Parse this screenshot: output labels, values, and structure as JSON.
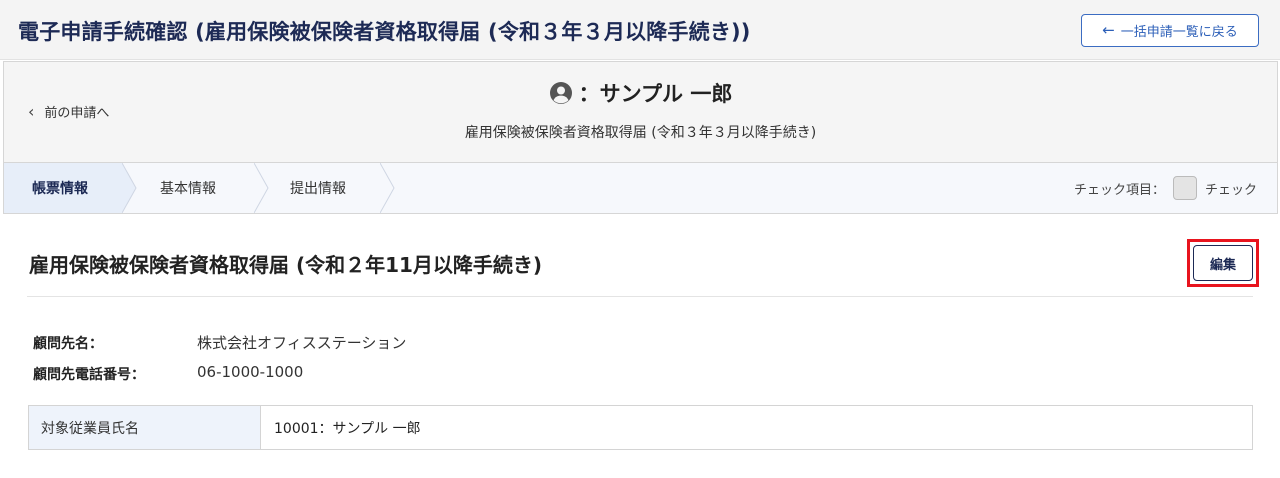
{
  "header": {
    "title": "電子申請手続確認 (雇用保険被保険者資格取得届 (令和３年３月以降手続き))",
    "back_button_label": "一括申請一覧に戻る"
  },
  "card": {
    "prev_label": "前の申請へ",
    "person_name": "：サンプル 一郎",
    "form_name": "雇用保険被保険者資格取得届 (令和３年３月以降手続き)"
  },
  "tabs": [
    {
      "label": "帳票情報",
      "active": true
    },
    {
      "label": "基本情報",
      "active": false
    },
    {
      "label": "提出情報",
      "active": false
    }
  ],
  "check": {
    "label": "チェック項目：",
    "checkbox_label": "チェック"
  },
  "section": {
    "title": "雇用保険被保険者資格取得届 (令和２年11月以降手続き)",
    "edit_label": "編集"
  },
  "info": [
    {
      "label": "顧問先名：",
      "value": "株式会社オフィスステーション"
    },
    {
      "label": "顧問先電話番号：",
      "value": "06-1000-1000"
    }
  ],
  "employee": {
    "label": "対象従業員氏名",
    "value": "10001：サンプル 一郎"
  },
  "colors": {
    "title": "#1d2a55",
    "accent_blue": "#2c5fb8",
    "highlight_red": "#e8141e"
  }
}
